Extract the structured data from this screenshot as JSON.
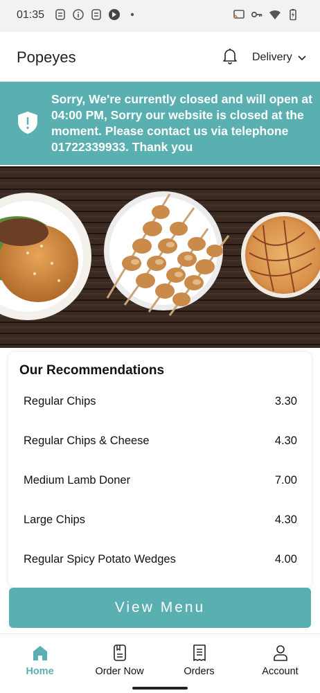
{
  "status_bar": {
    "time": "01:35"
  },
  "header": {
    "brand": "Popeyes",
    "delivery_label": "Delivery"
  },
  "banner": {
    "message": "Sorry, We're currently closed and will open at 04:00 PM, Sorry our website is closed at the moment. Please contact us via telephone 01722339933. Thank you"
  },
  "recommendations": {
    "title": "Our Recommendations",
    "items": [
      {
        "name": "Regular Chips",
        "price": "3.30"
      },
      {
        "name": "Regular Chips & Cheese",
        "price": "4.30"
      },
      {
        "name": "Medium Lamb Doner",
        "price": "7.00"
      },
      {
        "name": "Large Chips",
        "price": "4.30"
      },
      {
        "name": "Regular Spicy Potato Wedges",
        "price": "4.00"
      }
    ]
  },
  "view_menu_label": "View Menu",
  "bottom_nav": {
    "items": [
      {
        "label": "Home",
        "icon": "home-icon",
        "active": true
      },
      {
        "label": "Order Now",
        "icon": "order-now-icon",
        "active": false
      },
      {
        "label": "Orders",
        "icon": "orders-icon",
        "active": false
      },
      {
        "label": "Account",
        "icon": "account-icon",
        "active": false
      }
    ]
  },
  "colors": {
    "accent": "#5aafb0"
  }
}
